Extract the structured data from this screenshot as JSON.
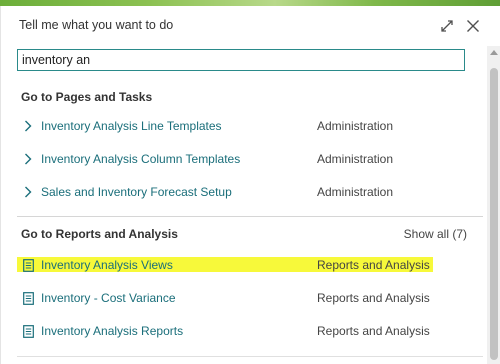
{
  "dialog": {
    "title": "Tell me what you want to do",
    "expand_icon": "expand-arrows-icon",
    "close_icon": "close-icon"
  },
  "search": {
    "value": "inventory an",
    "placeholder": ""
  },
  "pages_section": {
    "header": "Go to Pages and Tasks",
    "items": [
      {
        "label": "Inventory Analysis Line Templates",
        "category": "Administration",
        "icon": "chevron-right-icon"
      },
      {
        "label": "Inventory Analysis Column Templates",
        "category": "Administration",
        "icon": "chevron-right-icon"
      },
      {
        "label": "Sales and Inventory Forecast Setup",
        "category": "Administration",
        "icon": "chevron-right-icon"
      }
    ]
  },
  "reports_section": {
    "header": "Go to Reports and Analysis",
    "show_all": "Show all (7)",
    "items": [
      {
        "label": "Inventory Analysis Views",
        "category": "Reports and Analysis",
        "icon": "report-icon",
        "highlighted": true
      },
      {
        "label": "Inventory - Cost Variance",
        "category": "Reports and Analysis",
        "icon": "report-icon",
        "highlighted": false
      },
      {
        "label": "Inventory Analysis Reports",
        "category": "Reports and Analysis",
        "icon": "report-icon",
        "highlighted": false
      }
    ]
  },
  "colors": {
    "accent": "#1a6e7a",
    "search_border": "#2a8a8a",
    "highlight": "#f7f93a",
    "top_bar": "#8cc152"
  }
}
